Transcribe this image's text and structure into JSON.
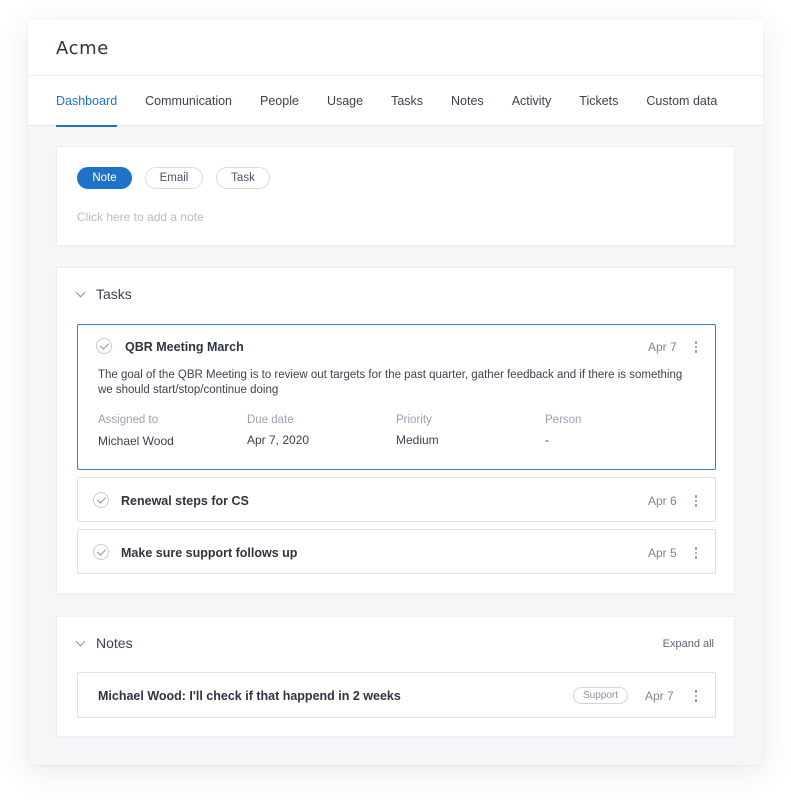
{
  "company": {
    "name": "Acme"
  },
  "tabs": [
    {
      "label": "Dashboard",
      "active": true
    },
    {
      "label": "Communication"
    },
    {
      "label": "People"
    },
    {
      "label": "Usage"
    },
    {
      "label": "Tasks"
    },
    {
      "label": "Notes"
    },
    {
      "label": "Activity"
    },
    {
      "label": "Tickets"
    },
    {
      "label": "Custom data"
    }
  ],
  "composer": {
    "types": [
      {
        "label": "Note",
        "active": true
      },
      {
        "label": "Email"
      },
      {
        "label": "Task"
      }
    ],
    "placeholder": "Click here to add a note"
  },
  "tasks_section": {
    "title": "Tasks",
    "items": [
      {
        "title": "QBR Meeting March",
        "date": "Apr 7",
        "description": "The goal of the QBR Meeting is to review out targets for the past quarter, gather feedback and if there is something we should start/stop/continue doing",
        "fields": [
          {
            "label": "Assigned to",
            "value": "Michael Wood"
          },
          {
            "label": "Due date",
            "value": "Apr 7, 2020"
          },
          {
            "label": "Priority",
            "value": "Medium"
          },
          {
            "label": "Person",
            "value": "-"
          }
        ]
      },
      {
        "title": "Renewal steps for CS",
        "date": "Apr 6"
      },
      {
        "title": "Make sure support follows up",
        "date": "Apr 5"
      }
    ]
  },
  "notes_section": {
    "title": "Notes",
    "expand_all_label": "Expand all",
    "items": [
      {
        "text": "Michael Wood: I'll check if that happend in 2 weeks",
        "tag": "Support",
        "date": "Apr 7"
      }
    ]
  },
  "icons": {
    "section_toggle": "chevron-down-icon",
    "task_complete": "check-circle-icon",
    "more_menu": "kebab-menu-icon"
  },
  "colors": {
    "accent": "#1f73c6",
    "text": "#3b4252",
    "muted": "#9aa2b0",
    "border": "#dde1e6"
  }
}
